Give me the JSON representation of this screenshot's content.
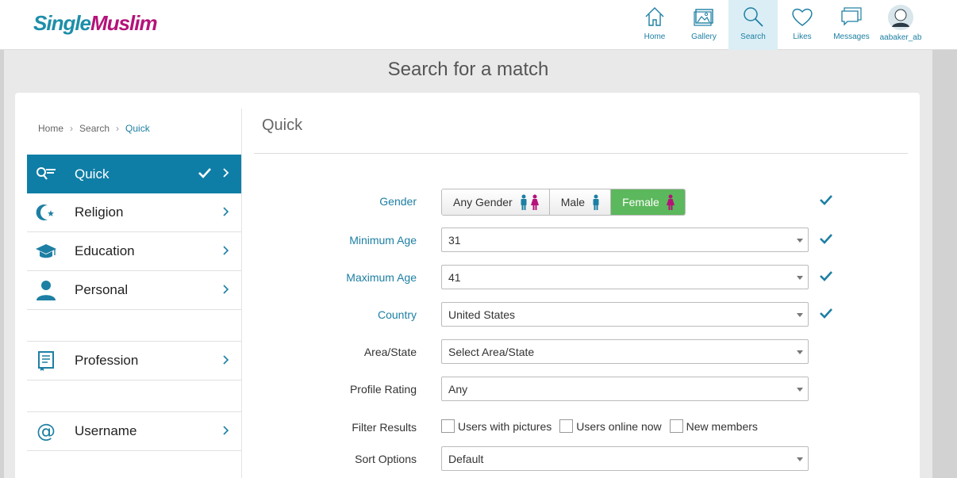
{
  "brand": {
    "part1": "Single",
    "part2": "Muslim"
  },
  "nav": [
    {
      "label": "Home",
      "icon": "home-icon"
    },
    {
      "label": "Gallery",
      "icon": "gallery-icon"
    },
    {
      "label": "Search",
      "icon": "search-icon",
      "active": true
    },
    {
      "label": "Likes",
      "icon": "heart-icon"
    },
    {
      "label": "Messages",
      "icon": "messages-icon"
    },
    {
      "label": "aabaker_ab",
      "icon": "avatar-icon"
    }
  ],
  "page_title": "Search for a match",
  "breadcrumb": [
    "Home",
    "Search",
    "Quick"
  ],
  "sidebar": {
    "items": [
      {
        "label": "Quick",
        "icon": "quick-search-icon",
        "active": true
      },
      {
        "label": "Religion",
        "icon": "crescent-star-icon"
      },
      {
        "label": "Education",
        "icon": "graduation-cap-icon"
      },
      {
        "label": "Personal",
        "icon": "person-icon"
      },
      {
        "label": "Profession",
        "icon": "certificate-icon"
      },
      {
        "label": "Username",
        "icon": "at-sign-icon"
      }
    ]
  },
  "section_title": "Quick",
  "form": {
    "gender": {
      "label": "Gender",
      "options": [
        "Any Gender",
        "Male",
        "Female"
      ],
      "selected": "Female"
    },
    "min_age": {
      "label": "Minimum Age",
      "value": "31"
    },
    "max_age": {
      "label": "Maximum Age",
      "value": "41"
    },
    "country": {
      "label": "Country",
      "value": "United States"
    },
    "area": {
      "label": "Area/State",
      "value": "Select Area/State"
    },
    "rating": {
      "label": "Profile Rating",
      "value": "Any"
    },
    "filter": {
      "label": "Filter Results",
      "options": [
        "Users with pictures",
        "Users online now",
        "New members"
      ]
    },
    "sort": {
      "label": "Sort Options",
      "value": "Default"
    }
  },
  "colors": {
    "accent": "#1d7fa3",
    "brand_pink": "#b5127a",
    "active_green": "#5cb85c",
    "sidebar_active": "#0f7ea6"
  }
}
